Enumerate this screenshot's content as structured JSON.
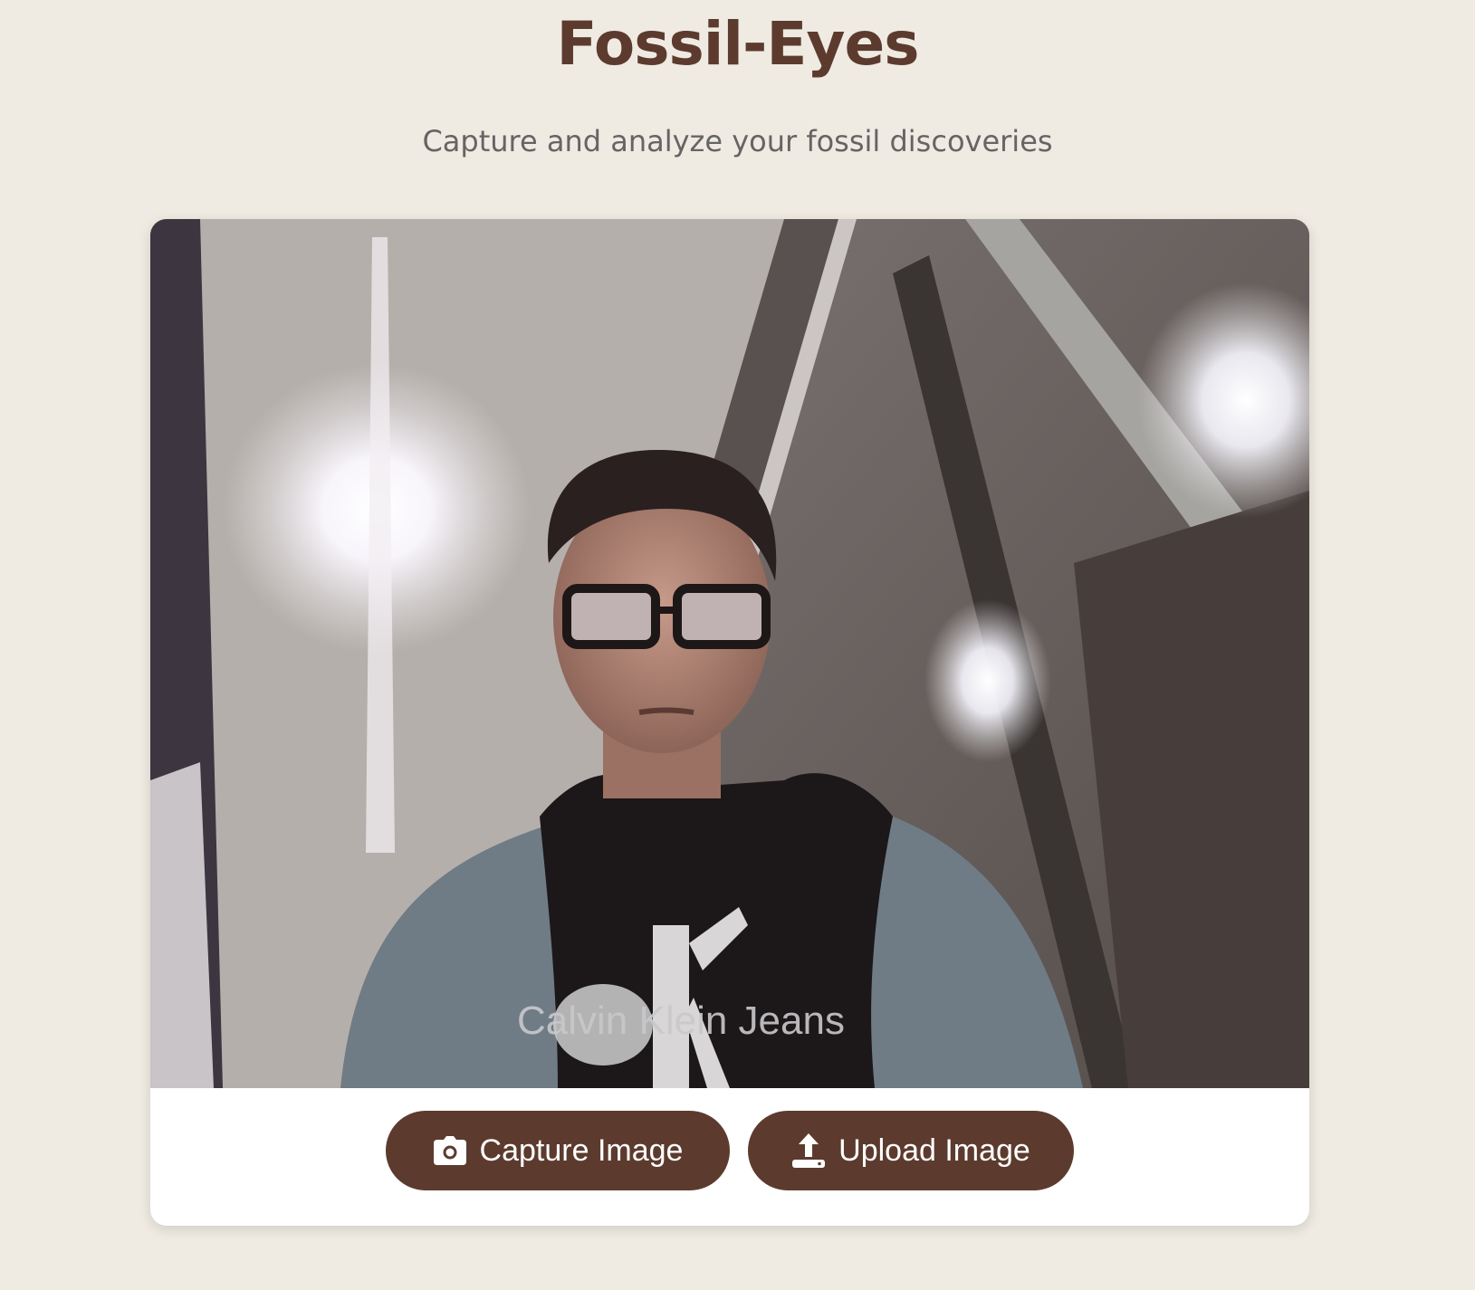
{
  "header": {
    "title": "Fossil-Eyes",
    "subtitle": "Capture and analyze your fossil discoveries"
  },
  "camera": {
    "shirt_text": "Calvin Klein Jeans"
  },
  "actions": {
    "capture_label": "Capture Image",
    "capture_icon": "camera-icon",
    "upload_label": "Upload Image",
    "upload_icon": "upload-icon"
  },
  "colors": {
    "background": "#efebe2",
    "accent": "#5c3b2e",
    "card": "#ffffff"
  }
}
